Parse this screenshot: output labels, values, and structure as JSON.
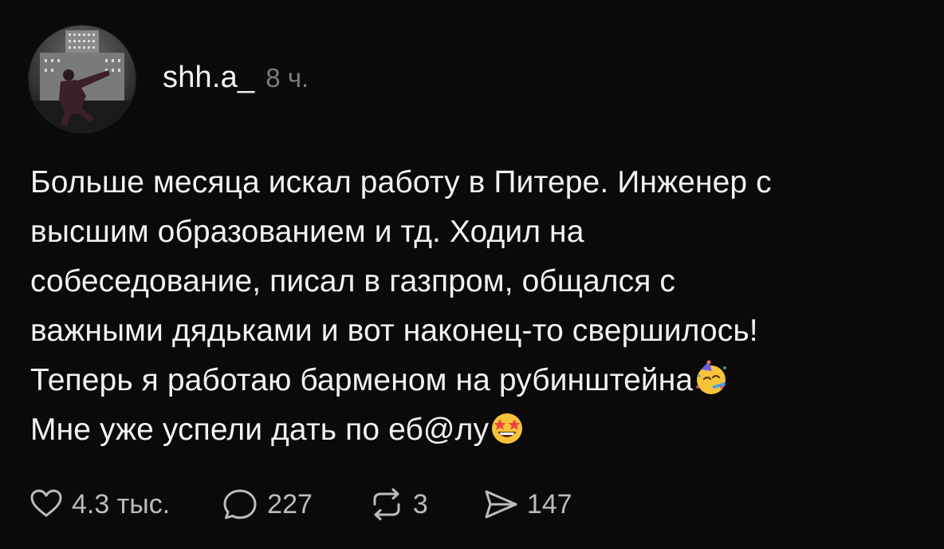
{
  "post": {
    "author": "shh.a_",
    "time": "8 ч.",
    "lines": [
      "Больше месяца искал работу в Питере. Инженер с",
      "высшим образованием и тд. Ходил на",
      "собеседование, писал в газпром, общался с",
      "важными дядьками и вот наконец-то свершилось!",
      "Теперь я работаю барменом на рубинштейна",
      "Мне уже успели дать по еб@лу"
    ],
    "emojis": [
      "partying-face",
      "star-struck"
    ]
  },
  "actions": {
    "likes": "4.3 тыс.",
    "comments": "227",
    "reposts": "3",
    "shares": "147"
  },
  "icons": [
    "heart-icon",
    "comment-icon",
    "repost-icon",
    "share-icon"
  ],
  "colors": {
    "background": "#0a0a0a",
    "text": "#f2f2f2",
    "muted": "#7c7c7c",
    "icon": "#bcbcbc"
  }
}
